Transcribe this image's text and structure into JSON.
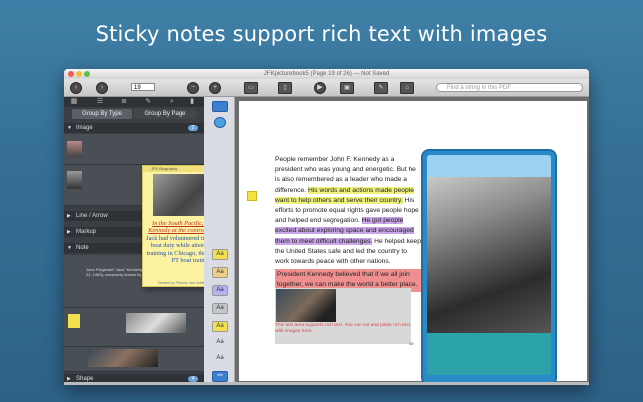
{
  "headline": "Sticky notes support rich text with images",
  "window": {
    "title": "JFKpicturebook5 (Page 19 of 26) — Not Saved",
    "page_field": "19",
    "search_placeholder": "Find a string in this PDF"
  },
  "sidebar": {
    "segments": [
      "Group By Type",
      "Group By Page"
    ],
    "sections": {
      "image": {
        "label": "Image",
        "count": "2"
      },
      "line_arrow": {
        "label": "Line / Arrow"
      },
      "markup": {
        "label": "Markup"
      },
      "note": {
        "label": "Note"
      },
      "shape": {
        "label": "Shape",
        "count": "4"
      }
    },
    "note_row_text": "John Fitzgerald \"Jack\" Kennedy (May 29, 1917 – November 22, 1963), commonly known by his initials JFK"
  },
  "sticky_note": {
    "header": "JFK Biography",
    "red_text": "In the South Pacific, Lt. John F. Kennedy at the controls of PT 109.",
    "blue_text": "Jack had volunteered in 1942 for PT boat duty while attending officer training in Chicago, then underwent PT boat training",
    "footer": "Created by Patricia, last modified on 5/26/13"
  },
  "rail": {
    "aa_label": "Aa"
  },
  "document": {
    "para_1": "People remember John F. Kennedy as a president who was young and energetic. But he is also remembered as a leader who made a difference. ",
    "hl_yellow": "His words and actions made people want to help others and serve their country.",
    "para_2": " His efforts to promote equal rights gave people hope and helped end segregation. ",
    "hl_purple": "He got people excited about exploring space and encouraged them to meet difficult challenges.",
    "para_3": " He helped keep the United States safe and led the country to work towards peace with other nations.",
    "hl_red": "President Kennedy believed that if we all join together, we can make the world a better place.",
    "caption": "This text area supports rich text. You can cut and paste rich text with images here.",
    "page_number": "19"
  },
  "colors": {
    "background": "#3a78a0",
    "highlight_yellow": "#eef27a",
    "highlight_purple": "#c9a6e8",
    "highlight_red": "#f08f8f",
    "device_frame": "#2a8ac8"
  }
}
